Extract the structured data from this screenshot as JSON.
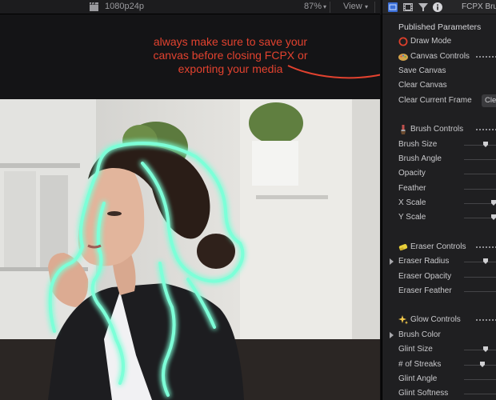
{
  "viewer": {
    "format": "1080p24p",
    "zoom": "87%",
    "view_menu": "View"
  },
  "annotation": {
    "lines": [
      "always make sure to save your",
      "canvas before closing FCPX or",
      "exporting your media"
    ],
    "color": "#e2422f"
  },
  "inspector": {
    "title": "FCPX Brus",
    "tabs": [
      "video-inspector-tab",
      "film-tab",
      "filter-tab",
      "info-tab"
    ],
    "published_header": "Published Parameters",
    "draw_mode": "Draw Mode",
    "canvas_controls": "Canvas Controls",
    "save_canvas": "Save Canvas",
    "clear_canvas": "Clear Canvas",
    "clear_current_frame": "Clear Current Frame",
    "clear_button": "Cle",
    "brush_controls": "Brush Controls",
    "brush_size": "Brush Size",
    "brush_angle": "Brush Angle",
    "opacity": "Opacity",
    "feather": "Feather",
    "x_scale": "X Scale",
    "y_scale": "Y Scale",
    "eraser_controls": "Eraser Controls",
    "eraser_radius": "Eraser Radius",
    "eraser_opacity": "Eraser Opacity",
    "eraser_feather": "Eraser Feather",
    "glow_controls": "Glow Controls",
    "brush_color": "Brush Color",
    "glint_size": "Glint Size",
    "num_streaks": "# of Streaks",
    "glint_angle": "Glint Angle",
    "glint_softness": "Glint Softness"
  },
  "colors": {
    "accent_blue": "#3b6fd8",
    "glow": "#7dffd8",
    "draw_mode_icon": "#e0402c"
  }
}
